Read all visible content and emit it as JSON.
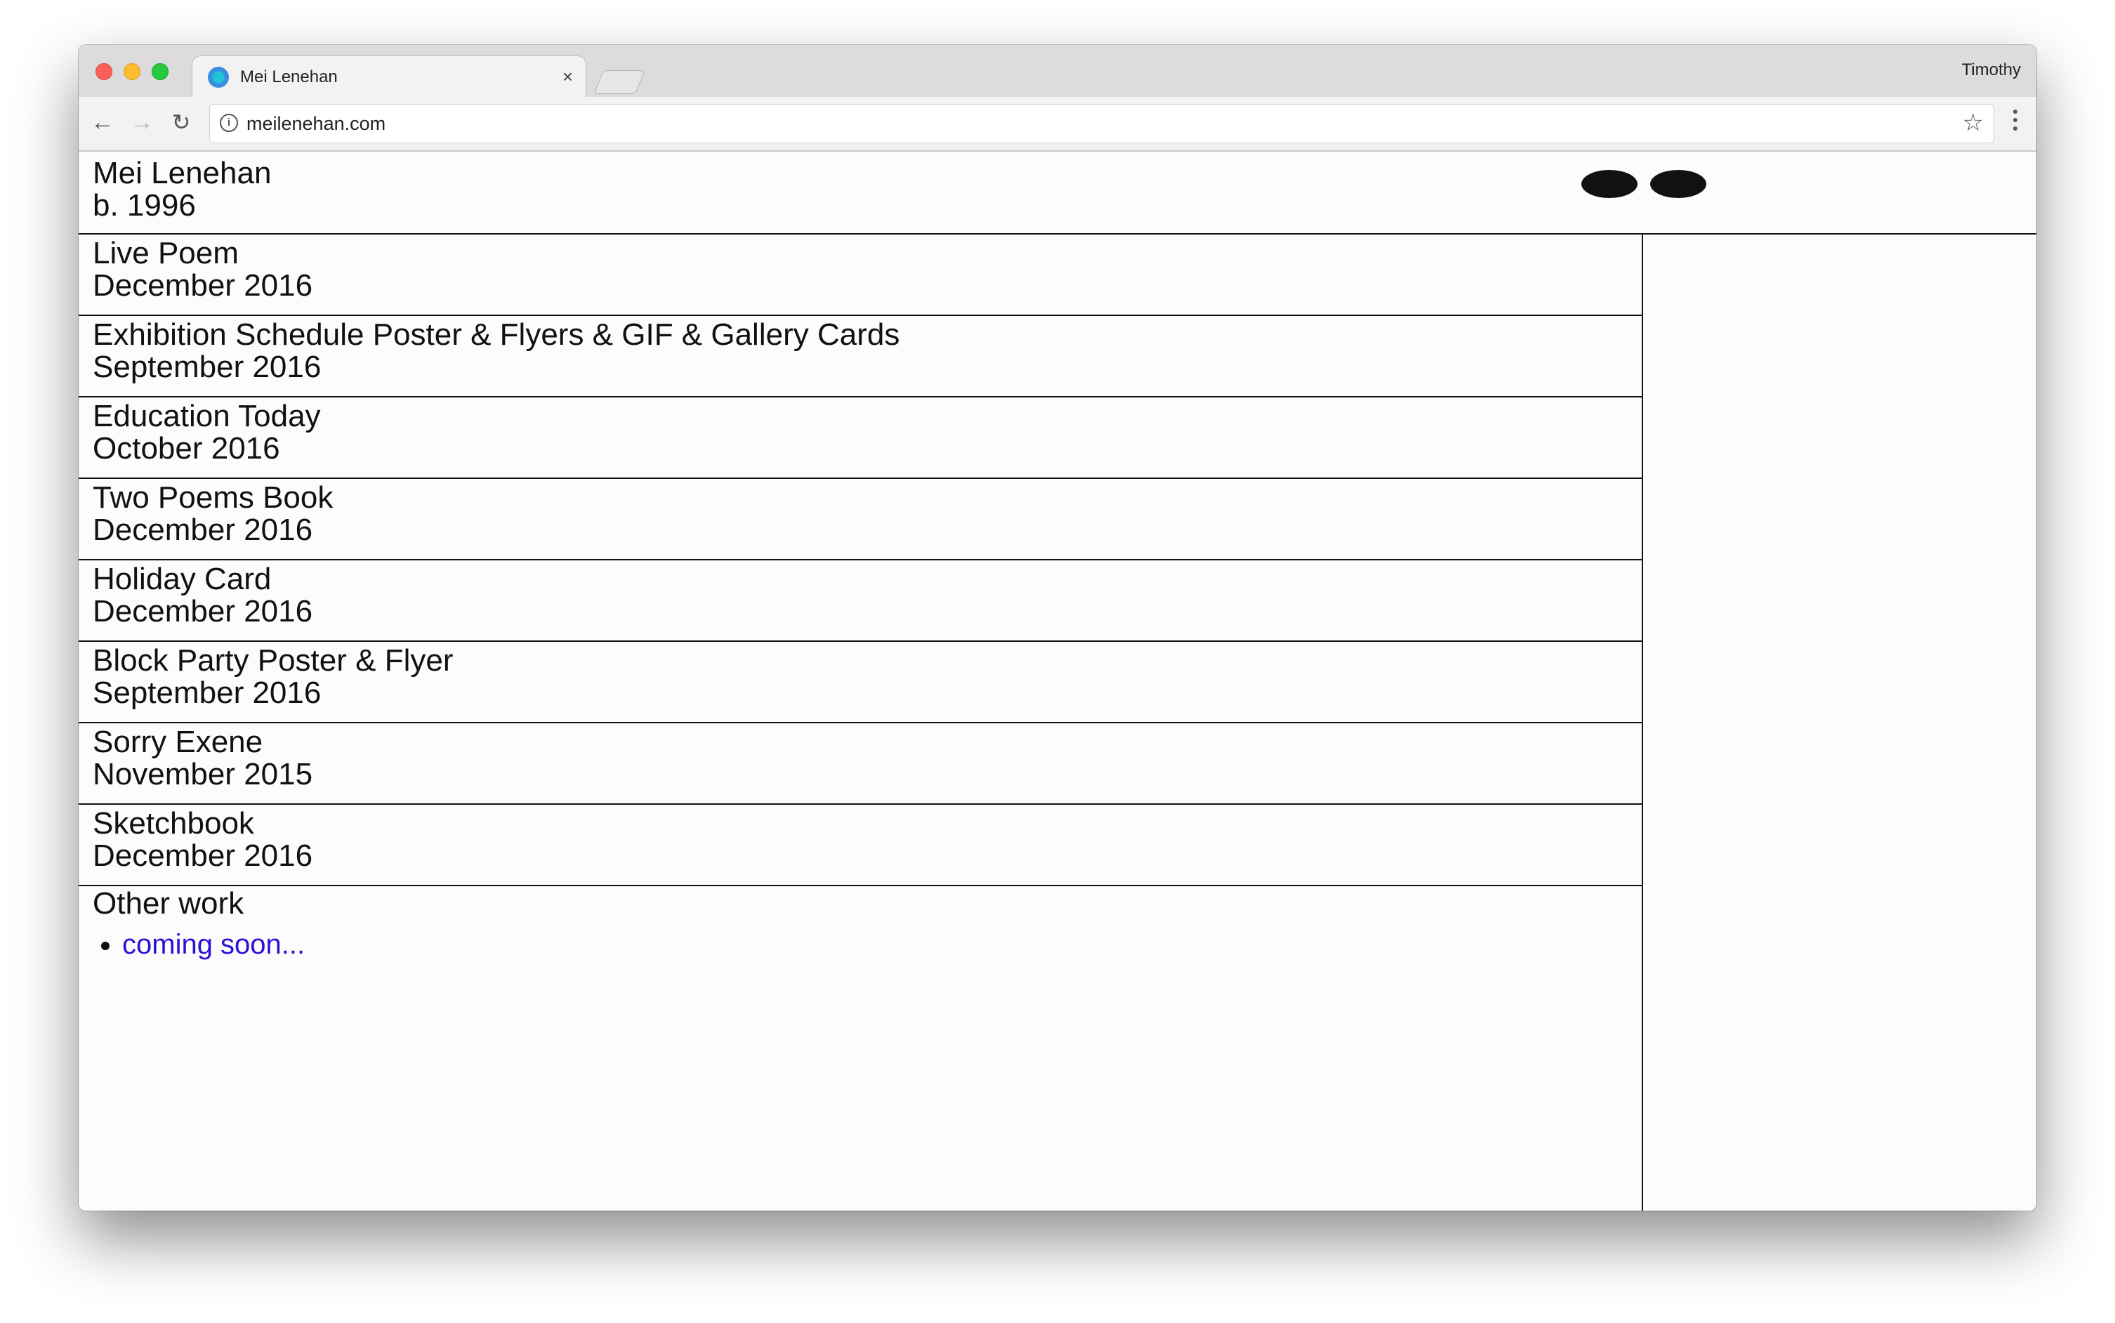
{
  "window": {
    "tab_title": "Mei Lenehan",
    "tab_close": "×",
    "profile_name": "Timothy"
  },
  "toolbar": {
    "back_icon": "←",
    "forward_icon": "→",
    "reload_icon": "↻",
    "info_icon": "i",
    "url": "meilenehan.com",
    "star_icon": "☆"
  },
  "site": {
    "name": "Mei Lenehan",
    "born": "b. 1996"
  },
  "projects": [
    {
      "title": "Live Poem",
      "date": "December 2016"
    },
    {
      "title": "Exhibition Schedule Poster & Flyers & GIF & Gallery Cards",
      "date": "September 2016"
    },
    {
      "title": "Education Today",
      "date": "October 2016"
    },
    {
      "title": "Two Poems Book",
      "date": "December 2016"
    },
    {
      "title": "Holiday Card",
      "date": "December 2016"
    },
    {
      "title": "Block Party Poster & Flyer",
      "date": "September 2016"
    },
    {
      "title": "Sorry Exene",
      "date": "November 2015"
    },
    {
      "title": "Sketchbook",
      "date": "December 2016"
    }
  ],
  "other_work": {
    "heading": "Other work",
    "link_label": "coming soon..."
  }
}
